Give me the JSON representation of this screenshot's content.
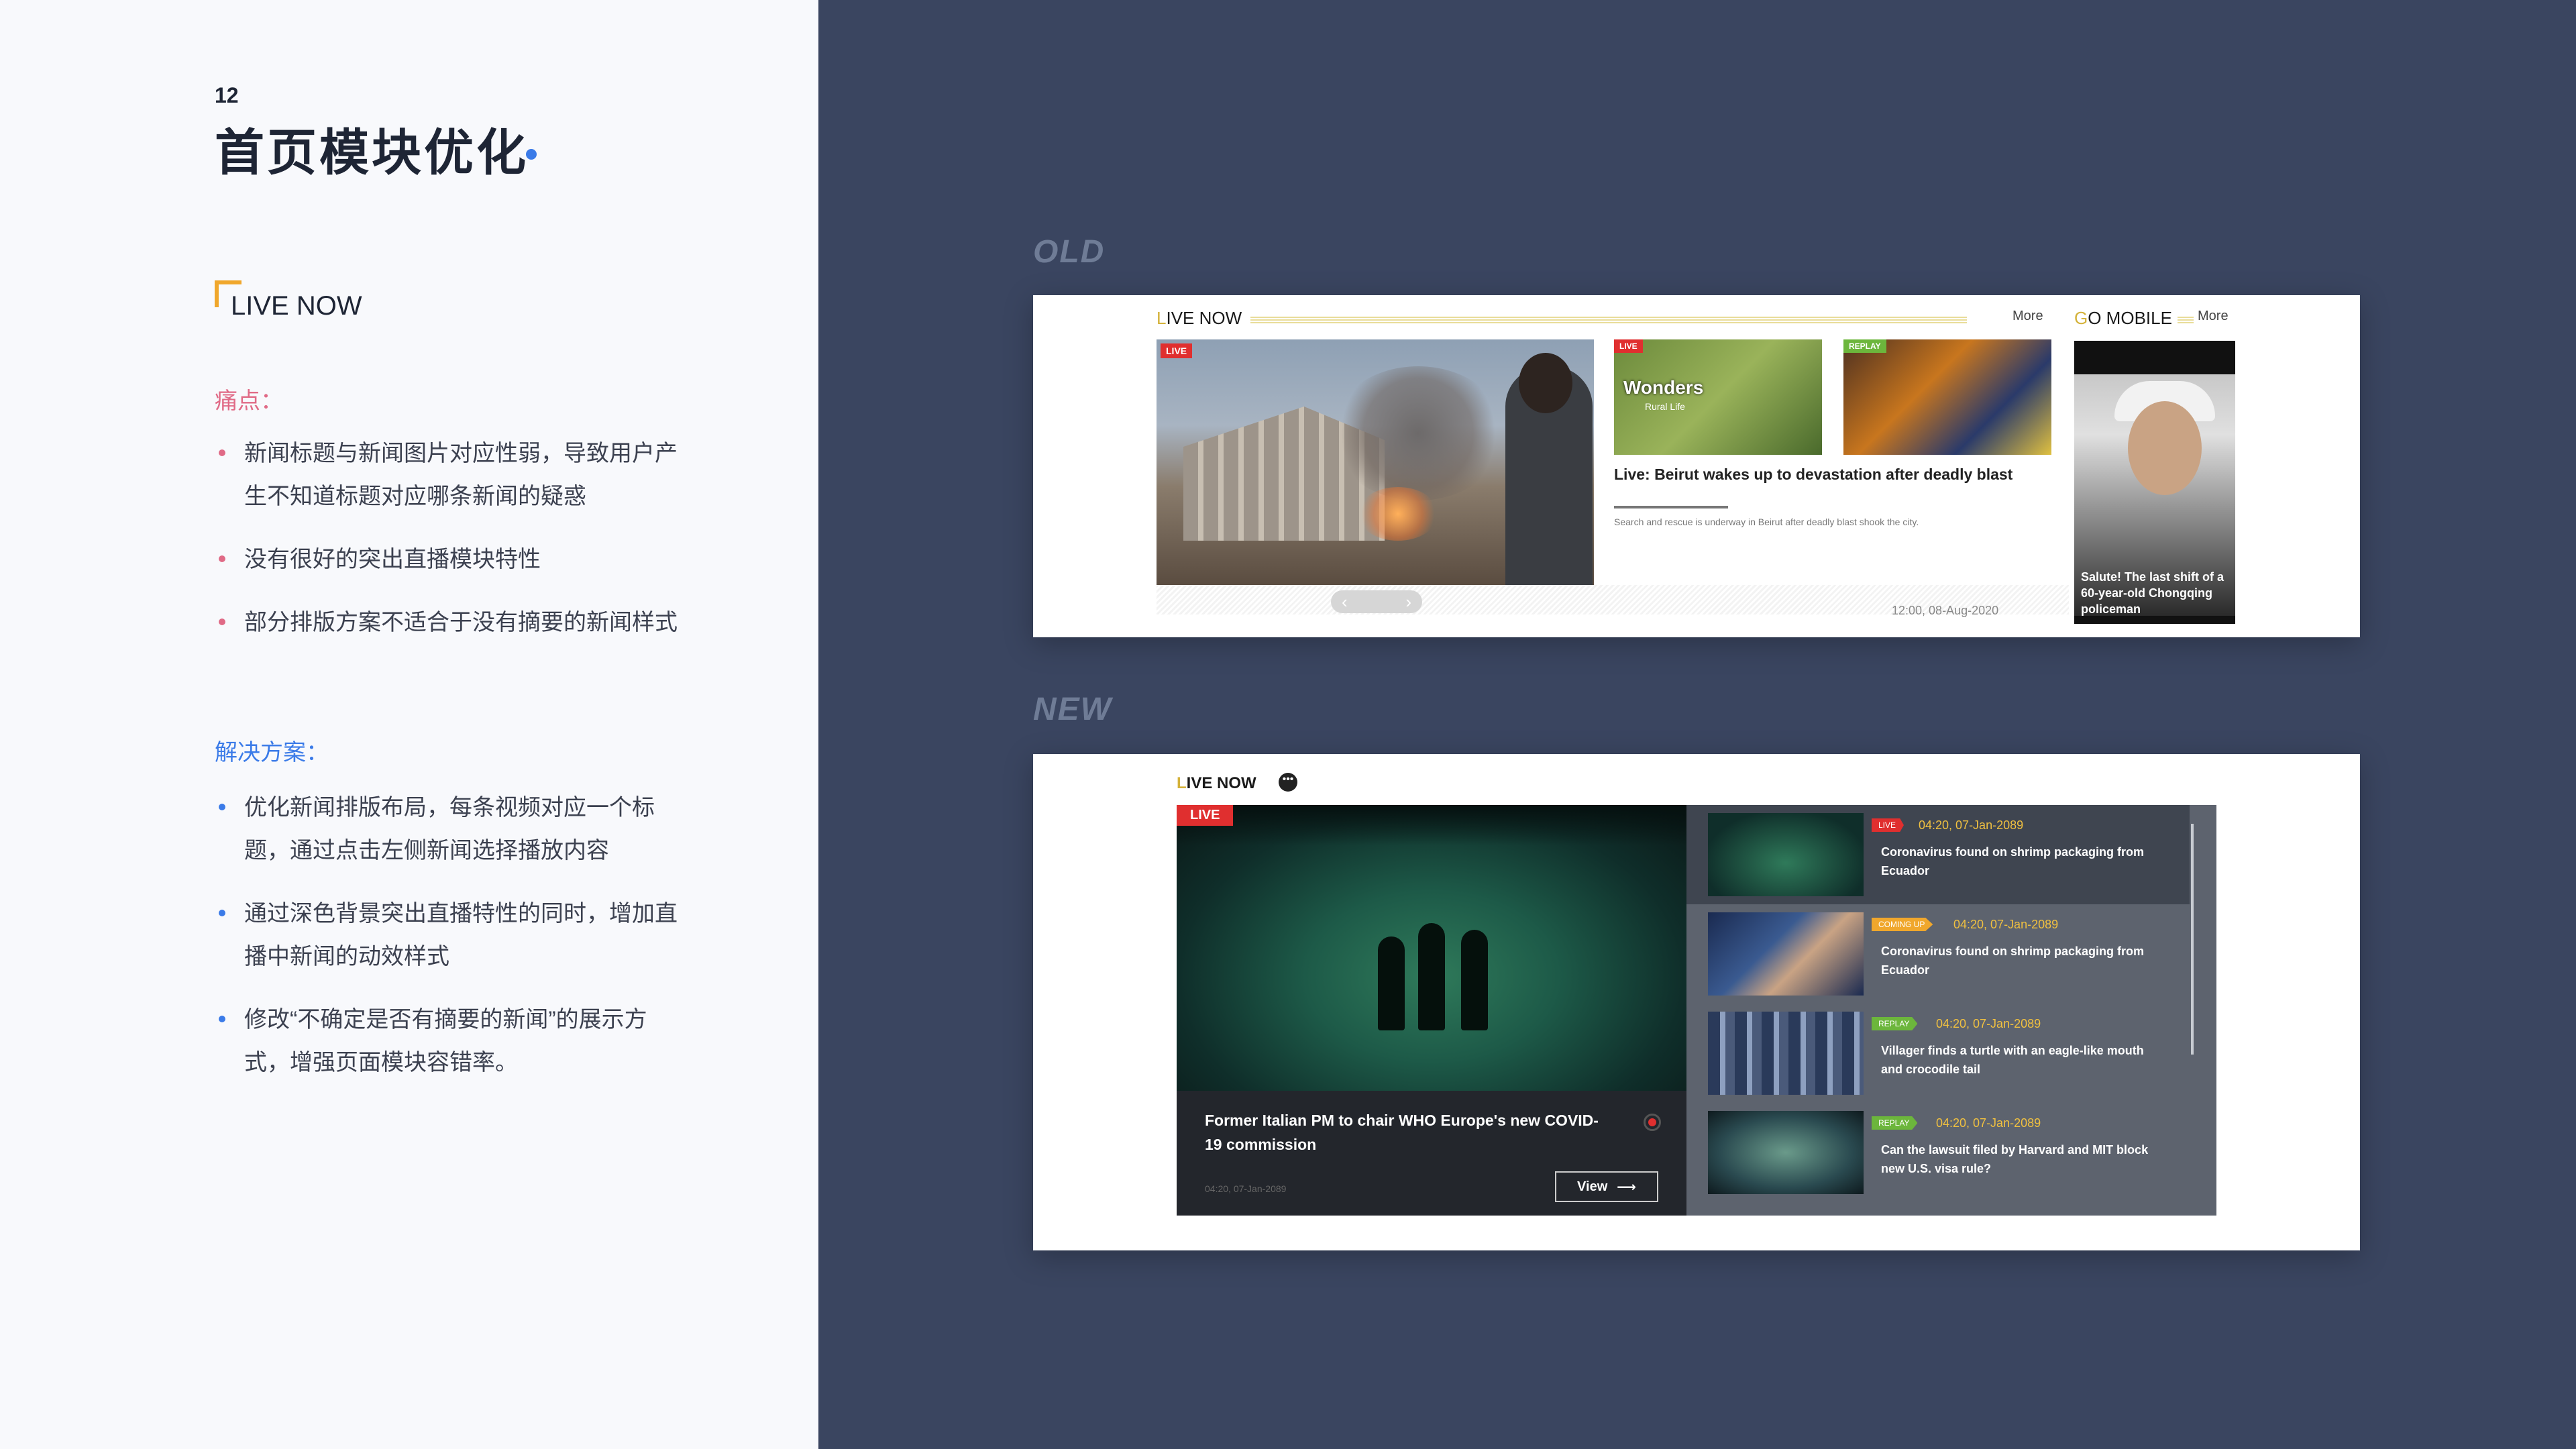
{
  "page": {
    "number": "12",
    "title": "首页模块优化"
  },
  "section": {
    "title": "LIVE NOW"
  },
  "pain": {
    "label": "痛点：",
    "items": [
      "新闻标题与新闻图片对应性弱，导致用户产生不知道标题对应哪条新闻的疑惑",
      "没有很好的突出直播模块特性",
      "部分排版方案不适合于没有摘要的新闻样式"
    ]
  },
  "solution": {
    "label": "解决方案：",
    "items": [
      "优化新闻排版布局，每条视频对应一个标题，通过点击左侧新闻选择播放内容",
      "通过深色背景突出直播特性的同时，增加直播中新闻的动效样式",
      "修改“不确定是否有摘要的新闻”的展示方式，增强页面模块容错率。"
    ]
  },
  "old": {
    "tag": "OLD",
    "live_title_first": "L",
    "live_title_rest": "IVE NOW",
    "more": "More",
    "gomobile_first": "G",
    "gomobile_rest": "O MOBILE",
    "main_badge": "LIVE",
    "thumb1_badge": "LIVE",
    "thumb1_brand": "Wonders",
    "thumb1_sub": "Rural Life",
    "thumb2_badge": "REPLAY",
    "headline": "Live: Beirut wakes up to devastation after deadly blast",
    "summary": "Search and rescue is underway in Beirut after deadly blast shook the city.",
    "time": "12:00, 08-Aug-2020",
    "arrow_left": "‹",
    "arrow_right": "›",
    "mobile_caption": "Salute! The last shift of a 60-year-old Chongqing policeman"
  },
  "new": {
    "tag": "NEW",
    "title_first": "L",
    "title_rest": "IVE NOW",
    "more_icon": "•••",
    "player_badge": "LIVE",
    "headline": "Former Italian PM to chair WHO Europe's new COVID-19 commission",
    "time": "04:20, 07-Jan-2089",
    "view_label": "View",
    "view_arrow": "⟶",
    "items": [
      {
        "badge": "LIVE",
        "time": "04:20, 07-Jan-2089",
        "text": "Coronavirus found on shrimp packaging from Ecuador"
      },
      {
        "badge": "COMING UP",
        "time": "04:20, 07-Jan-2089",
        "text": "Coronavirus found on shrimp packaging from Ecuador"
      },
      {
        "badge": "REPLAY",
        "time": "04:20, 07-Jan-2089",
        "text": "Villager finds a turtle with an eagle-like mouth and crocodile tail"
      },
      {
        "badge": "REPLAY",
        "time": "04:20, 07-Jan-2089",
        "text": "Can the lawsuit filed by Harvard and MIT block new U.S. visa rule?"
      }
    ]
  },
  "colors": {
    "accent_blue": "#3b7be8",
    "accent_pink": "#e06a86",
    "accent_gold": "#f0a72c",
    "live_red": "#e02f2f",
    "replay_green": "#6cb63c",
    "background_navy": "#3a4560"
  }
}
